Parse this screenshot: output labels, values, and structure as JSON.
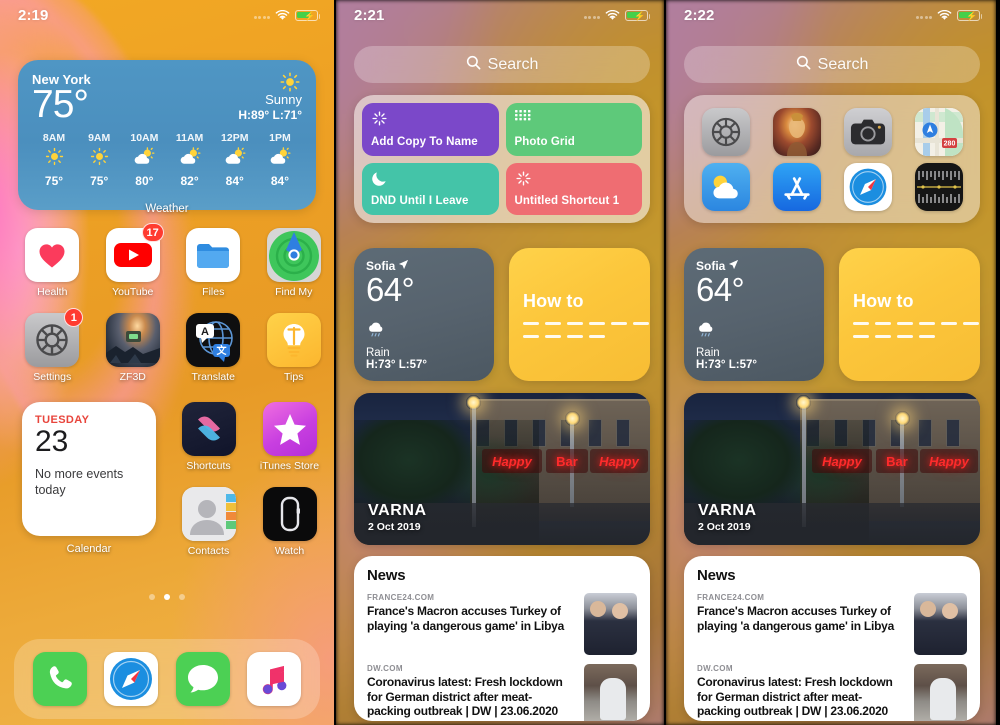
{
  "panels": [
    {
      "id": "home-screen-page",
      "status": {
        "time": "2:19",
        "wifi": "wifi-icon",
        "battery": "battery-charging-icon",
        "signal": "signal-dots-icon"
      },
      "weather_widget": {
        "city": "New York",
        "temp": "75°",
        "condition": "Sunny",
        "high_low": "H:89° L:71°",
        "icon": "sun-icon",
        "widget_label": "Weather",
        "hourly": [
          {
            "hour": "8AM",
            "icon": "sun-icon",
            "temp": "75°"
          },
          {
            "hour": "9AM",
            "icon": "sun-icon",
            "temp": "75°"
          },
          {
            "hour": "10AM",
            "icon": "sun-cloud-icon",
            "temp": "80°"
          },
          {
            "hour": "11AM",
            "icon": "sun-cloud-icon",
            "temp": "82°"
          },
          {
            "hour": "12PM",
            "icon": "sun-cloud-icon",
            "temp": "84°"
          },
          {
            "hour": "1PM",
            "icon": "sun-cloud-icon",
            "temp": "84°"
          }
        ]
      },
      "apps_row1": [
        {
          "label": "Health",
          "icon": "health-heart-icon",
          "badge": ""
        },
        {
          "label": "YouTube",
          "icon": "youtube-play-icon",
          "badge": "17"
        },
        {
          "label": "Files",
          "icon": "files-folder-icon",
          "badge": ""
        },
        {
          "label": "Find My",
          "icon": "find-my-radar-icon",
          "badge": ""
        }
      ],
      "apps_row2": [
        {
          "label": "Settings",
          "icon": "settings-gear-icon",
          "badge": "1"
        },
        {
          "label": "ZF3D",
          "icon": "game-artwork-icon",
          "badge": ""
        },
        {
          "label": "Translate",
          "icon": "translate-globe-icon",
          "badge": ""
        },
        {
          "label": "Tips",
          "icon": "tips-bulb-icon",
          "badge": ""
        }
      ],
      "calendar_widget": {
        "weekday": "TUESDAY",
        "day_number": "23",
        "events_text": "No more events today",
        "widget_label": "Calendar"
      },
      "page_dots": {
        "count": 3,
        "active_index": 1
      },
      "dock": [
        {
          "label": "Phone",
          "icon": "phone-handset-icon"
        },
        {
          "label": "Safari",
          "icon": "safari-compass-icon"
        },
        {
          "label": "Messages",
          "icon": "messages-bubble-icon"
        },
        {
          "label": "Music",
          "icon": "music-note-icon"
        }
      ]
    },
    {
      "id": "today-view-shortcuts-page",
      "status": {
        "time": "2:21",
        "wifi": "wifi-icon",
        "battery": "battery-charging-icon",
        "signal": "signal-dots-icon"
      },
      "search": {
        "placeholder": "Search",
        "icon": "search-icon"
      },
      "shortcuts_widget": {
        "tiles": [
          {
            "name": "Add Copy To Name",
            "icon": "sparkle-burst-icon",
            "color": "#7b48c9"
          },
          {
            "name": "Photo Grid",
            "icon": "grid-dots-icon",
            "color": "#5ec97a"
          },
          {
            "name": "DND Until I Leave",
            "icon": "moon-icon",
            "color": "#44c4a8"
          },
          {
            "name": "Untitled Shortcut 1",
            "icon": "sparkle-burst-icon",
            "color": "#ef6d72"
          }
        ]
      },
      "weather_widget": {
        "city": "Sofia",
        "location_icon": "location-arrow-icon",
        "temp": "64°",
        "condition": "Rain",
        "condition_icon": "rain-cloud-icon",
        "high_low": "H:73° L:57°"
      },
      "howto_widget": {
        "title": "How to",
        "icon": "dashed-lines-icon"
      },
      "photos_widget": {
        "title": "VARNA",
        "date": "2 Oct 2019",
        "neon_left": "Happy",
        "neon_mid": "Bar",
        "neon_right": "Happy"
      },
      "news_widget": {
        "title": "News",
        "stories": [
          {
            "source": "FRANCE24.COM",
            "headline": "France's Macron accuses Turkey of playing 'a dangerous game' in Libya",
            "thumb": "macron-photo-thumb"
          },
          {
            "source": "DW.COM",
            "headline": "Coronavirus latest: Fresh lockdown for German district after meat-packing outbreak | DW | 23.06.2020",
            "thumb": "hazmat-photo-thumb"
          }
        ]
      }
    },
    {
      "id": "today-view-app-suggestions-page",
      "status": {
        "time": "2:22",
        "wifi": "wifi-icon",
        "battery": "battery-charging-icon",
        "signal": "signal-dots-icon"
      },
      "search": {
        "placeholder": "Search",
        "icon": "search-icon"
      },
      "app_suggestions_widget": {
        "apps": [
          {
            "label": "Settings",
            "icon": "settings-gear-icon"
          },
          {
            "label": "Game",
            "icon": "game-artwork-icon"
          },
          {
            "label": "Camera",
            "icon": "camera-icon"
          },
          {
            "label": "Maps",
            "icon": "maps-icon"
          },
          {
            "label": "Weather",
            "icon": "weather-sun-cloud-icon"
          },
          {
            "label": "App Store",
            "icon": "app-store-icon"
          },
          {
            "label": "Safari",
            "icon": "safari-compass-icon"
          },
          {
            "label": "Measure",
            "icon": "measure-ruler-icon"
          }
        ]
      },
      "weather_widget": {
        "city": "Sofia",
        "location_icon": "location-arrow-icon",
        "temp": "64°",
        "condition": "Rain",
        "condition_icon": "rain-cloud-icon",
        "high_low": "H:73° L:57°"
      },
      "howto_widget": {
        "title": "How to",
        "icon": "dashed-lines-icon"
      },
      "photos_widget": {
        "title": "VARNA",
        "date": "2 Oct 2019",
        "neon_left": "Happy",
        "neon_mid": "Bar",
        "neon_right": "Happy"
      },
      "news_widget": {
        "title": "News",
        "stories": [
          {
            "source": "FRANCE24.COM",
            "headline": "France's Macron accuses Turkey of playing 'a dangerous game' in Libya",
            "thumb": "macron-photo-thumb"
          },
          {
            "source": "DW.COM",
            "headline": "Coronavirus latest: Fresh lockdown for German district after meat-packing outbreak | DW | 23.06.2020",
            "thumb": "hazmat-photo-thumb"
          }
        ]
      }
    }
  ],
  "colors": {
    "accent_blue": "#4f96c4",
    "badge_red": "#ff3b30",
    "battery_green": "#44d04a",
    "widget_yellow": "#ffd24a"
  }
}
